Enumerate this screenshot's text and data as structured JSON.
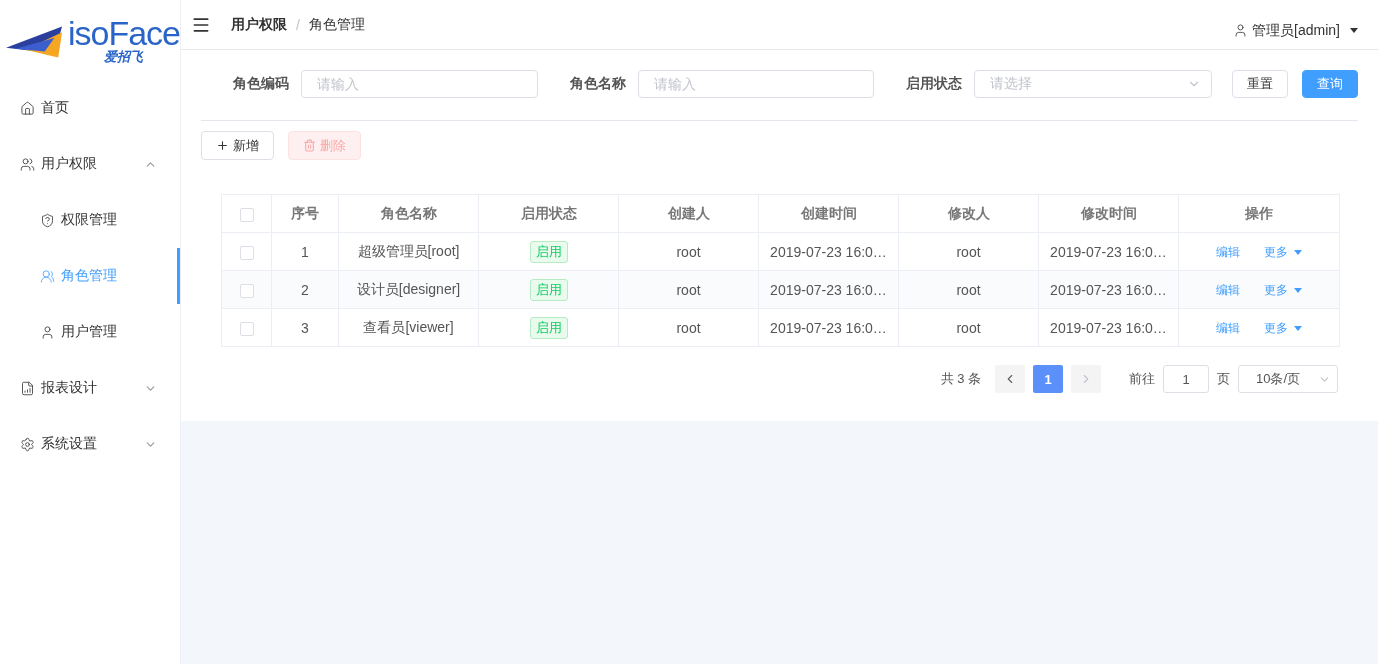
{
  "logo": {
    "wordmark": "isoFace",
    "subtitle": "爱招飞"
  },
  "sidebar": {
    "items": [
      {
        "label": "首页",
        "selected": false
      },
      {
        "label": "用户权限",
        "expanded": true,
        "selected": false,
        "children": [
          {
            "label": "权限管理",
            "selected": false
          },
          {
            "label": "角色管理",
            "selected": true
          },
          {
            "label": "用户管理",
            "selected": false
          }
        ]
      },
      {
        "label": "报表设计",
        "expanded": false,
        "selected": false
      },
      {
        "label": "系统设置",
        "expanded": false,
        "selected": false
      }
    ]
  },
  "breadcrumb": [
    "用户权限",
    "角色管理"
  ],
  "breadcrumb_separator": "/",
  "user": {
    "name": "管理员[admin]"
  },
  "filters": [
    {
      "label": "角色编码",
      "kind": "input",
      "placeholder": "请输入"
    },
    {
      "label": "角色名称",
      "kind": "input",
      "placeholder": "请输入"
    },
    {
      "label": "启用状态",
      "kind": "select",
      "placeholder": "请选择"
    }
  ],
  "filter_buttons": [
    {
      "label": "重置",
      "primary": false
    },
    {
      "label": "查询",
      "primary": true
    }
  ],
  "actions": [
    {
      "label": "新增",
      "disabled": false
    },
    {
      "label": "删除",
      "disabled": true
    }
  ],
  "table": {
    "header_checked": false,
    "columns": [
      "序号",
      "角色名称",
      "启用状态",
      "创建人",
      "创建时间",
      "修改人",
      "修改时间",
      "操作"
    ],
    "rows": [
      {
        "checked": false,
        "index": "1",
        "name": "超级管理员[root]",
        "status": "启用",
        "creator": "root",
        "created": "2019-07-23 16:0…",
        "modifier": "root",
        "modified": "2019-07-23 16:0…",
        "edit": "编辑",
        "more": "更多"
      },
      {
        "checked": false,
        "index": "2",
        "name": "设计员[designer]",
        "status": "启用",
        "creator": "root",
        "created": "2019-07-23 16:0…",
        "modifier": "root",
        "modified": "2019-07-23 16:0…",
        "edit": "编辑",
        "more": "更多"
      },
      {
        "checked": false,
        "index": "3",
        "name": "查看员[viewer]",
        "status": "启用",
        "creator": "root",
        "created": "2019-07-23 16:0…",
        "modifier": "root",
        "modified": "2019-07-23 16:0…",
        "edit": "编辑",
        "more": "更多"
      }
    ]
  },
  "pagination": {
    "total": "共 3 条",
    "pages": [
      {
        "label": "1",
        "selected": true
      }
    ],
    "goto_label": "前往",
    "goto_value": "1",
    "goto_suffix": "页",
    "page_size": "10条/页"
  }
}
